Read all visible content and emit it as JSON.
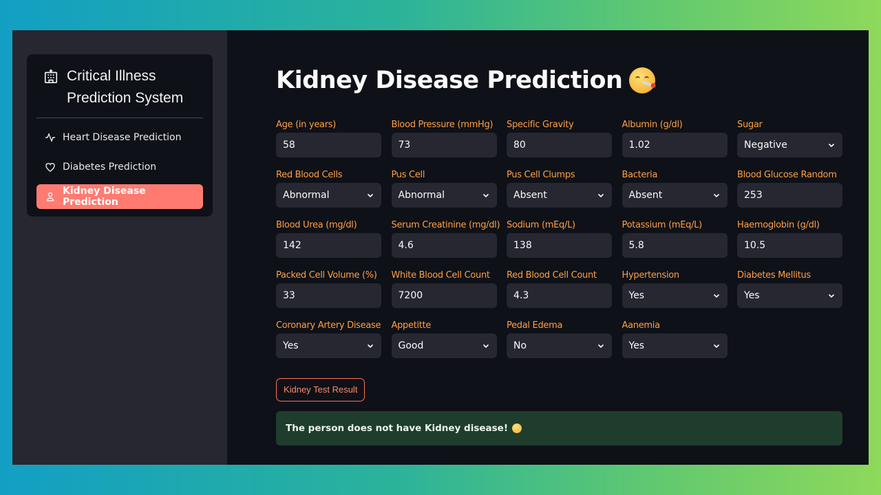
{
  "sidebar": {
    "title": "Critical Illness Prediction System",
    "items": [
      {
        "label": "Heart Disease Prediction",
        "icon": "activity-icon"
      },
      {
        "label": "Diabetes Prediction",
        "icon": "heart-icon"
      },
      {
        "label": "Kidney Disease Prediction",
        "icon": "person-icon",
        "active": true
      }
    ]
  },
  "main": {
    "title": "Kidney Disease Prediction",
    "fields": [
      {
        "label": "Age (in years)",
        "value": "58",
        "type": "input"
      },
      {
        "label": "Blood Pressure (mmHg)",
        "value": "73",
        "type": "input"
      },
      {
        "label": "Specific Gravity",
        "value": "80",
        "type": "input"
      },
      {
        "label": "Albumin (g/dl)",
        "value": "1.02",
        "type": "input"
      },
      {
        "label": "Sugar",
        "value": "Negative",
        "type": "select"
      },
      {
        "label": "Red Blood Cells",
        "value": "Abnormal",
        "type": "select"
      },
      {
        "label": "Pus Cell",
        "value": "Abnormal",
        "type": "select"
      },
      {
        "label": "Pus Cell Clumps",
        "value": "Absent",
        "type": "select"
      },
      {
        "label": "Bacteria",
        "value": "Absent",
        "type": "select"
      },
      {
        "label": "Blood Glucose Random",
        "value": "253",
        "type": "input"
      },
      {
        "label": "Blood Urea (mg/dl)",
        "value": "142",
        "type": "input"
      },
      {
        "label": "Serum Creatinine (mg/dl)",
        "value": "4.6",
        "type": "input"
      },
      {
        "label": "Sodium (mEq/L)",
        "value": "138",
        "type": "input"
      },
      {
        "label": "Potassium (mEq/L)",
        "value": "5.8",
        "type": "input"
      },
      {
        "label": "Haemoglobin (g/dl)",
        "value": "10.5",
        "type": "input"
      },
      {
        "label": "Packed Cell Volume (%)",
        "value": "33",
        "type": "input"
      },
      {
        "label": "White Blood Cell Count",
        "value": "7200",
        "type": "input"
      },
      {
        "label": "Red Blood Cell Count",
        "value": "4.3",
        "type": "input"
      },
      {
        "label": "Hypertension",
        "value": "Yes",
        "type": "select"
      },
      {
        "label": "Diabetes Mellitus",
        "value": "Yes",
        "type": "select"
      },
      {
        "label": "Coronary Artery Disease",
        "value": "Yes",
        "type": "select"
      },
      {
        "label": "Appetitte",
        "value": "Good",
        "type": "select"
      },
      {
        "label": "Pedal Edema",
        "value": "No",
        "type": "select"
      },
      {
        "label": "Aanemia",
        "value": "Yes",
        "type": "select"
      }
    ],
    "button_label": "Kidney Test Result",
    "result_text": "The person does not have Kidney disease!"
  },
  "colors": {
    "accent": "#ff7b72",
    "label": "#ff9f43",
    "success_bg": "#1f3d2c"
  }
}
